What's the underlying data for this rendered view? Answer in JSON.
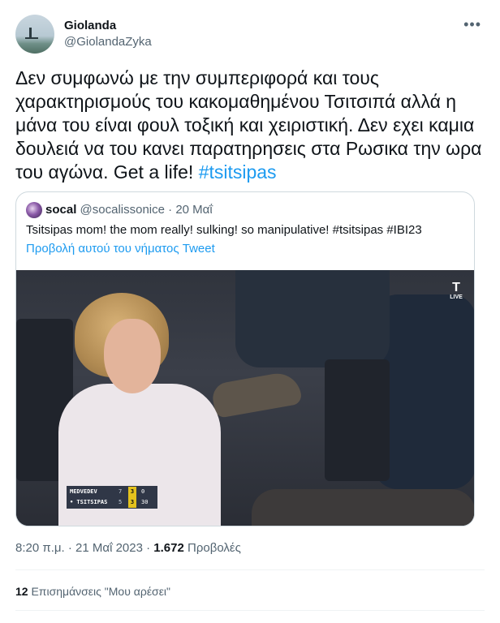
{
  "author": {
    "display_name": "Giolanda",
    "handle": "@GiolandaZyka",
    "more_icon": "more-horizontal-icon"
  },
  "tweet": {
    "text": "Δεν συμφωνώ με την συμπεριφορά και τους χαρακτηρισμούς του κακομαθημένου Τσιτσιπά αλλά η μάνα του είναι φουλ τοξική και χειριστική. Δεν εχει καμια δουλειά να του κανει παρατηρησεις στα Ρωσικα την ωρα του αγώνα. Get a life!",
    "hashtag": "#tsitsipas"
  },
  "quote": {
    "name": "socal",
    "handle": "@socalissonice",
    "separator": "·",
    "date": "20 Μαΐ",
    "text": "Tsitsipas mom!  the mom really!  sulking!  so manipulative!   #tsitsipas #IBI23",
    "link": "Προβολή αυτού του νήματος Tweet",
    "media": {
      "live_label": "LIVE",
      "scoreboard": [
        {
          "name": "MEDVEDEV",
          "sets": "7",
          "games": "3",
          "points": "0"
        },
        {
          "name": "• TSITSIPAS",
          "sets": "5",
          "games": "3",
          "points": "30"
        }
      ]
    }
  },
  "meta": {
    "time": "8:20 π.μ.",
    "date": "21 Μαΐ 2023",
    "separator": "·",
    "views_count": "1.672",
    "views_label": "Προβολές"
  },
  "likes": {
    "count": "12",
    "label": "Επισημάνσεις \"Μου αρέσει\""
  },
  "colors": {
    "text": "#0f1419",
    "secondary": "#536471",
    "link": "#1d9bf0",
    "border": "#cfd9de"
  }
}
